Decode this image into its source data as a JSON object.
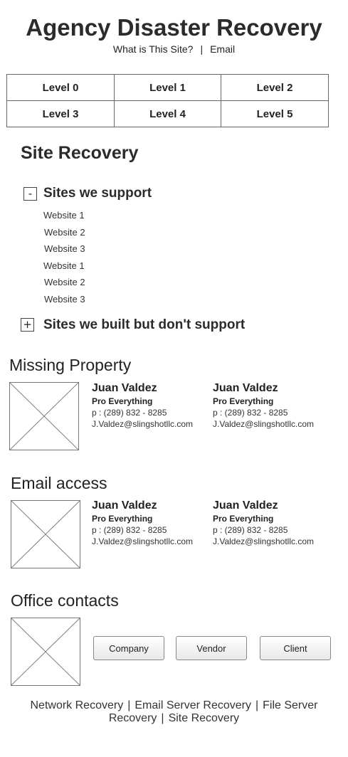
{
  "header": {
    "title": "Agency Disaster Recovery",
    "links": [
      "What is This Site?",
      "Email"
    ],
    "separator": "|"
  },
  "levels": [
    "Level 0",
    "Level 1",
    "Level 2",
    "Level 3",
    "Level 4",
    "Level 5"
  ],
  "site_recovery": {
    "heading": "Site Recovery",
    "supported": {
      "toggle": "-",
      "title": "Sites we support",
      "items": [
        "Website 1",
        "Website 2",
        "Website 3",
        "Website 1",
        "Website 2",
        "Website 3"
      ]
    },
    "unsupported": {
      "toggle": "+",
      "title": "Sites we built but don't support"
    }
  },
  "missing_property": {
    "heading": "Missing Property",
    "contacts": [
      {
        "name": "Juan Valdez",
        "role": "Pro Everything",
        "phone": "p : (289) 832 - 8285",
        "email": "J.Valdez@slingshotllc.com"
      },
      {
        "name": "Juan Valdez",
        "role": "Pro Everything",
        "phone": "p : (289) 832 - 8285",
        "email": "J.Valdez@slingshotllc.com"
      }
    ]
  },
  "email_access": {
    "heading": "Email access",
    "contacts": [
      {
        "name": "Juan Valdez",
        "role": "Pro Everything",
        "phone": "p : (289) 832 - 8285",
        "email": "J.Valdez@slingshotllc.com"
      },
      {
        "name": "Juan Valdez",
        "role": "Pro Everything",
        "phone": "p : (289) 832 - 8285",
        "email": "J.Valdez@slingshotllc.com"
      }
    ]
  },
  "office_contacts": {
    "heading": "Office contacts",
    "buttons": [
      "Company",
      "Vendor",
      "Client"
    ]
  },
  "footer": {
    "links": [
      "Network Recovery",
      "Email Server Recovery",
      "File Server Recovery",
      "Site Recovery"
    ],
    "separator": "|"
  }
}
